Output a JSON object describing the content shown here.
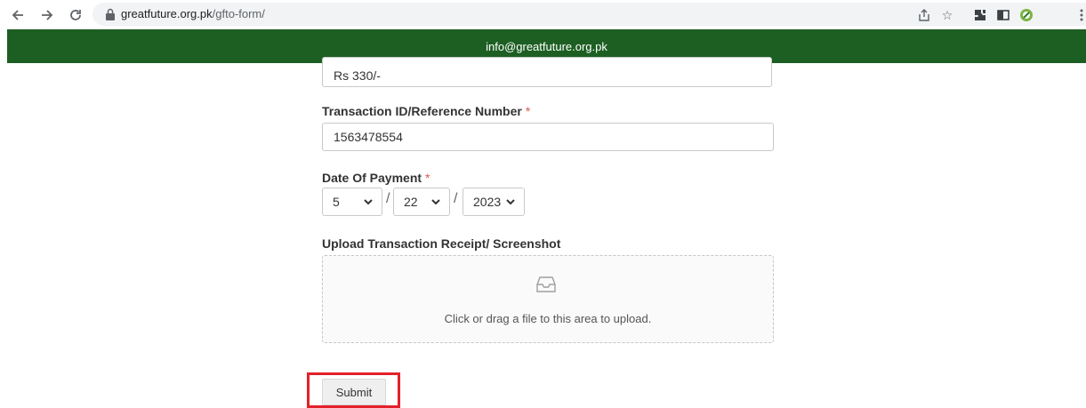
{
  "browser": {
    "url_host": "greatfuture.org.pk",
    "url_path": "/gfto-form/",
    "icons": [
      "back-arrow-icon",
      "forward-arrow-icon",
      "reload-icon",
      "lock-icon",
      "share-icon",
      "star-icon",
      "extensions-icon",
      "sidepanel-icon",
      "extension-badge-icon",
      "menu-icon"
    ]
  },
  "banner": {
    "email": "info@greatfuture.org.pk"
  },
  "form": {
    "amount_value": "Rs 330/-",
    "transaction": {
      "label": "Transaction ID/Reference Number",
      "required": "*",
      "value": "1563478554"
    },
    "date": {
      "label": "Date Of Payment",
      "required": "*",
      "month": "5",
      "day": "22",
      "year": "2023",
      "separator": "/"
    },
    "upload": {
      "label": "Upload Transaction Receipt/ Screenshot",
      "hint": "Click or drag a file to this area to upload."
    },
    "submit_label": "Submit"
  },
  "colors": {
    "banner": "#1d5f23",
    "required": "#e0544b",
    "highlight": "#e3212b"
  }
}
